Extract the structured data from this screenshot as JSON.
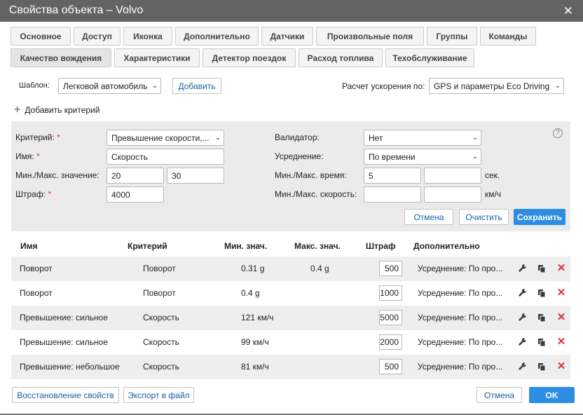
{
  "window": {
    "title": "Свойства объекта – Volvo",
    "close": "✕"
  },
  "tabs": {
    "row1": [
      "Основное",
      "Доступ",
      "Иконка",
      "Дополнительно",
      "Датчики",
      "Произвольные поля",
      "Группы",
      "Команды"
    ],
    "row2": [
      "Качество вождения",
      "Характеристики",
      "Детектор поездок",
      "Расход топлива",
      "Техобслуживание"
    ],
    "active": "Качество вождения"
  },
  "template": {
    "label": "Шаблон:",
    "value": "Легковой автомобиль",
    "add_button": "Добавить"
  },
  "acceleration": {
    "label": "Расчет ускорения по:",
    "value": "GPS и параметры Eco Driving"
  },
  "add_criterion": {
    "label": "Добавить критерий"
  },
  "form": {
    "criterion_label": "Критерий:",
    "criterion_value": "Превышение скорости,...",
    "name_label": "Имя:",
    "name_value": "Скорость",
    "minmax_label": "Мин./Макс. значение:",
    "min_value": "20",
    "max_value": "30",
    "penalty_label": "Штраф:",
    "penalty_value": "4000",
    "validator_label": "Валидатор:",
    "validator_value": "Нет",
    "averaging_label": "Усреднение:",
    "averaging_value": "По времени",
    "time_label": "Мин./Макс. время:",
    "time_min": "5",
    "time_max": "",
    "time_unit": "сек.",
    "speed_label": "Мин./Макс. скорость:",
    "speed_min": "",
    "speed_max": "",
    "speed_unit": "км/ч",
    "help": "?",
    "cancel": "Отмена",
    "clear": "Очистить",
    "save": "Сохранить",
    "required_mark": "*"
  },
  "table": {
    "headers": [
      "Имя",
      "Критерий",
      "Мин. знач.",
      "Макс. знач.",
      "Штраф",
      "Дополнительно"
    ],
    "rows": [
      {
        "name": "Поворот",
        "criterion": "Поворот",
        "min": "0.31 g",
        "max": "0.4 g",
        "penalty": "500",
        "extra": "Усреднение: По про..."
      },
      {
        "name": "Поворот",
        "criterion": "Поворот",
        "min": "0.4 g",
        "max": "",
        "penalty": "1000",
        "extra": "Усреднение: По про..."
      },
      {
        "name": "Превышение: сильное",
        "criterion": "Скорость",
        "min": "121 км/ч",
        "max": "",
        "penalty": "5000",
        "extra": "Усреднение: По про..."
      },
      {
        "name": "Превышение: сильное",
        "criterion": "Скорость",
        "min": "99 км/ч",
        "max": "",
        "penalty": "2000",
        "extra": "Усреднение: По про..."
      },
      {
        "name": "Превышение: небольшое",
        "criterion": "Скорость",
        "min": "81 км/ч",
        "max": "",
        "penalty": "500",
        "extra": "Усреднение: По про..."
      }
    ]
  },
  "footer": {
    "restore": "Восстановление свойств",
    "export": "Экспорт в файл",
    "cancel": "Отмена",
    "ok": "OK"
  },
  "icons": {
    "edit": "wrench-icon",
    "copy": "copy-icon",
    "delete": "delete-icon"
  },
  "colors": {
    "titlebar": "#636363",
    "primary": "#2c8de3",
    "danger": "#e03131",
    "link": "#1f5fa5"
  }
}
